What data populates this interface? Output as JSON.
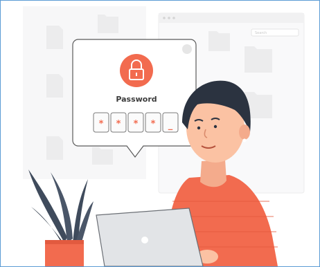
{
  "password_popup": {
    "title": "Password",
    "input_chars": [
      "*",
      "*",
      "*",
      "*",
      "_"
    ]
  },
  "background_window": {
    "search_placeholder": "Search"
  },
  "colors": {
    "accent": "#f26b4f",
    "hair": "#2b3340",
    "skin": "#fbc2a3",
    "plant": "#3f4b5c",
    "laptop": "#e2e4e7",
    "frame_border": "#5b9bd5"
  },
  "icons": [
    "lock-icon",
    "folder-icon",
    "document-icon",
    "close-icon",
    "laptop-logo-icon"
  ]
}
